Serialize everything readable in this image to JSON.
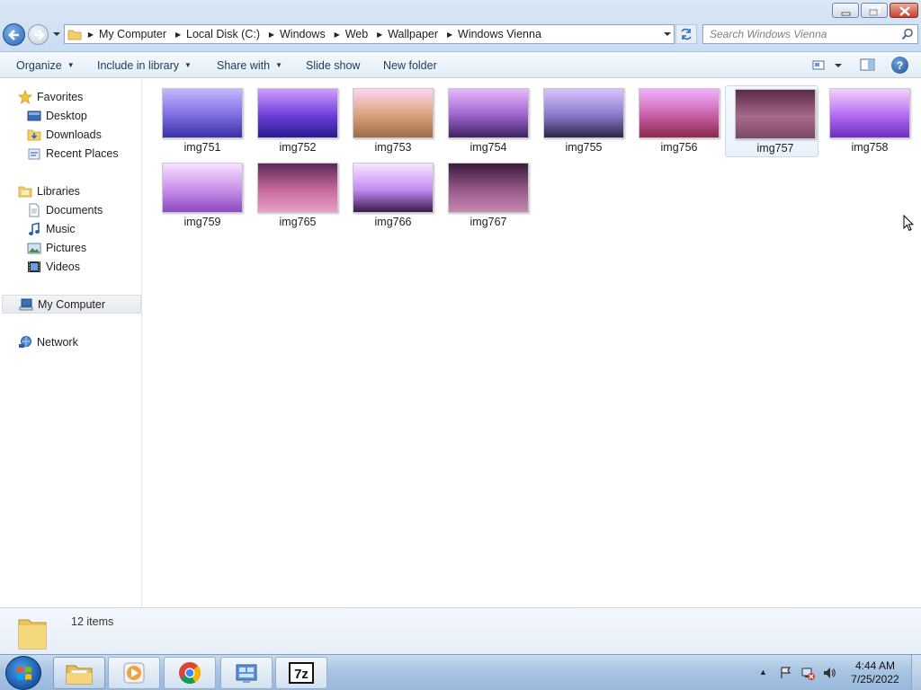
{
  "address": {
    "crumbs": [
      "My Computer",
      "Local Disk (C:)",
      "Windows",
      "Web",
      "Wallpaper",
      "Windows Vienna"
    ]
  },
  "search": {
    "placeholder": "Search Windows Vienna"
  },
  "toolbar": {
    "organize": "Organize",
    "include_in_library": "Include in library",
    "share_with": "Share with",
    "slide_show": "Slide show",
    "new_folder": "New folder",
    "help": "?"
  },
  "nav": {
    "favorites": "Favorites",
    "desktop": "Desktop",
    "downloads": "Downloads",
    "recent_places": "Recent Places",
    "libraries": "Libraries",
    "documents": "Documents",
    "music": "Music",
    "pictures": "Pictures",
    "videos": "Videos",
    "my_computer": "My Computer",
    "network": "Network"
  },
  "files": [
    {
      "name": "img751",
      "colors": [
        "#c7b6ff",
        "#7a6de0",
        "#3b2fa6"
      ]
    },
    {
      "name": "img752",
      "colors": [
        "#d09cff",
        "#6b3fd8",
        "#2b1a8f"
      ]
    },
    {
      "name": "img753",
      "colors": [
        "#ffd6f0",
        "#d9a07a",
        "#9b6a4a"
      ]
    },
    {
      "name": "img754",
      "colors": [
        "#e8b8ff",
        "#9a63c9",
        "#3d2360"
      ]
    },
    {
      "name": "img755",
      "colors": [
        "#d8c3ff",
        "#8a78c9",
        "#2e2446"
      ]
    },
    {
      "name": "img756",
      "colors": [
        "#f0b0ff",
        "#c85fa8",
        "#8a2a4c"
      ]
    },
    {
      "name": "img757",
      "colors": [
        "#5a2a4a",
        "#a86a8a",
        "#7a4868"
      ]
    },
    {
      "name": "img758",
      "colors": [
        "#f3d2ff",
        "#b46af0",
        "#6a2fc0"
      ]
    },
    {
      "name": "img759",
      "colors": [
        "#f8e0ff",
        "#c78ee8",
        "#8a4ac0"
      ]
    },
    {
      "name": "img765",
      "colors": [
        "#5b2a5a",
        "#c86a9a",
        "#e8a0c8"
      ]
    },
    {
      "name": "img766",
      "colors": [
        "#f6e6ff",
        "#c08af0",
        "#3a1a4a"
      ]
    },
    {
      "name": "img767",
      "colors": [
        "#3a1a3a",
        "#9a5a8a",
        "#c58ab0"
      ]
    }
  ],
  "details": {
    "item_count": "12 items"
  },
  "taskbar": {
    "pinned": [
      "explorer",
      "media-player",
      "chrome",
      "control-panel",
      "7zip"
    ],
    "time": "4:44 AM",
    "date": "7/25/2022"
  }
}
